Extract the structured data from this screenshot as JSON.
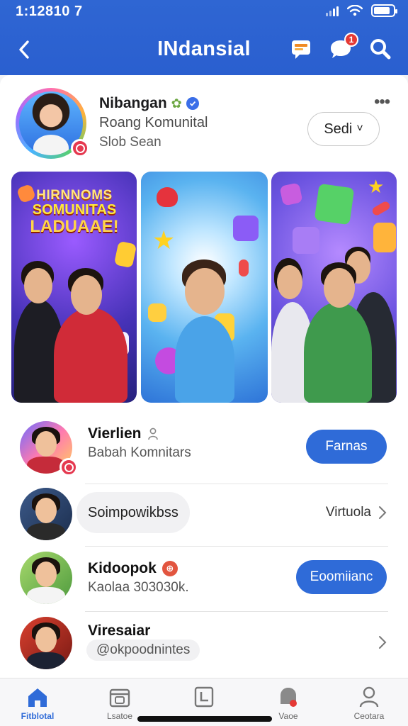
{
  "status_bar": {
    "time": "1:12810 7"
  },
  "header": {
    "title": "INdansial",
    "notification_count": "1"
  },
  "profile": {
    "name": "Nibangan",
    "subtitle": "Roang Komunital",
    "meta": "Slob Sean",
    "action_label": "Sedi",
    "action_chevron": "˅"
  },
  "gallery": {
    "banner_line1": "HIRNNOMS",
    "banner_line2": "SOMUNITAS",
    "banner_line3": "LADUAAE!"
  },
  "list": [
    {
      "title": "Vierlien",
      "subtitle": "Babah Komnitars",
      "action": "Farnas"
    },
    {
      "title": "Soimpowikbss",
      "action": "Virtuola"
    },
    {
      "title": "Kidoopok",
      "subtitle": "Kaolaa 303030k.",
      "action": "Eoomiianc"
    },
    {
      "title": "Viresaiar",
      "subtitle": "@okpoodnintes"
    }
  ],
  "bottom_nav": [
    {
      "label": "Fitblotal",
      "icon": "home-icon",
      "active": true
    },
    {
      "label": "Lsatoe",
      "icon": "calendar-icon",
      "active": false
    },
    {
      "label": "",
      "icon": "book-icon",
      "active": false
    },
    {
      "label": "Vaoe",
      "icon": "bell-icon",
      "active": false
    },
    {
      "label": "Ceotara",
      "icon": "profile-icon",
      "active": false
    }
  ],
  "colors": {
    "brand": "#2f66d3",
    "button": "#2f6bd8",
    "badge": "#e53935"
  }
}
